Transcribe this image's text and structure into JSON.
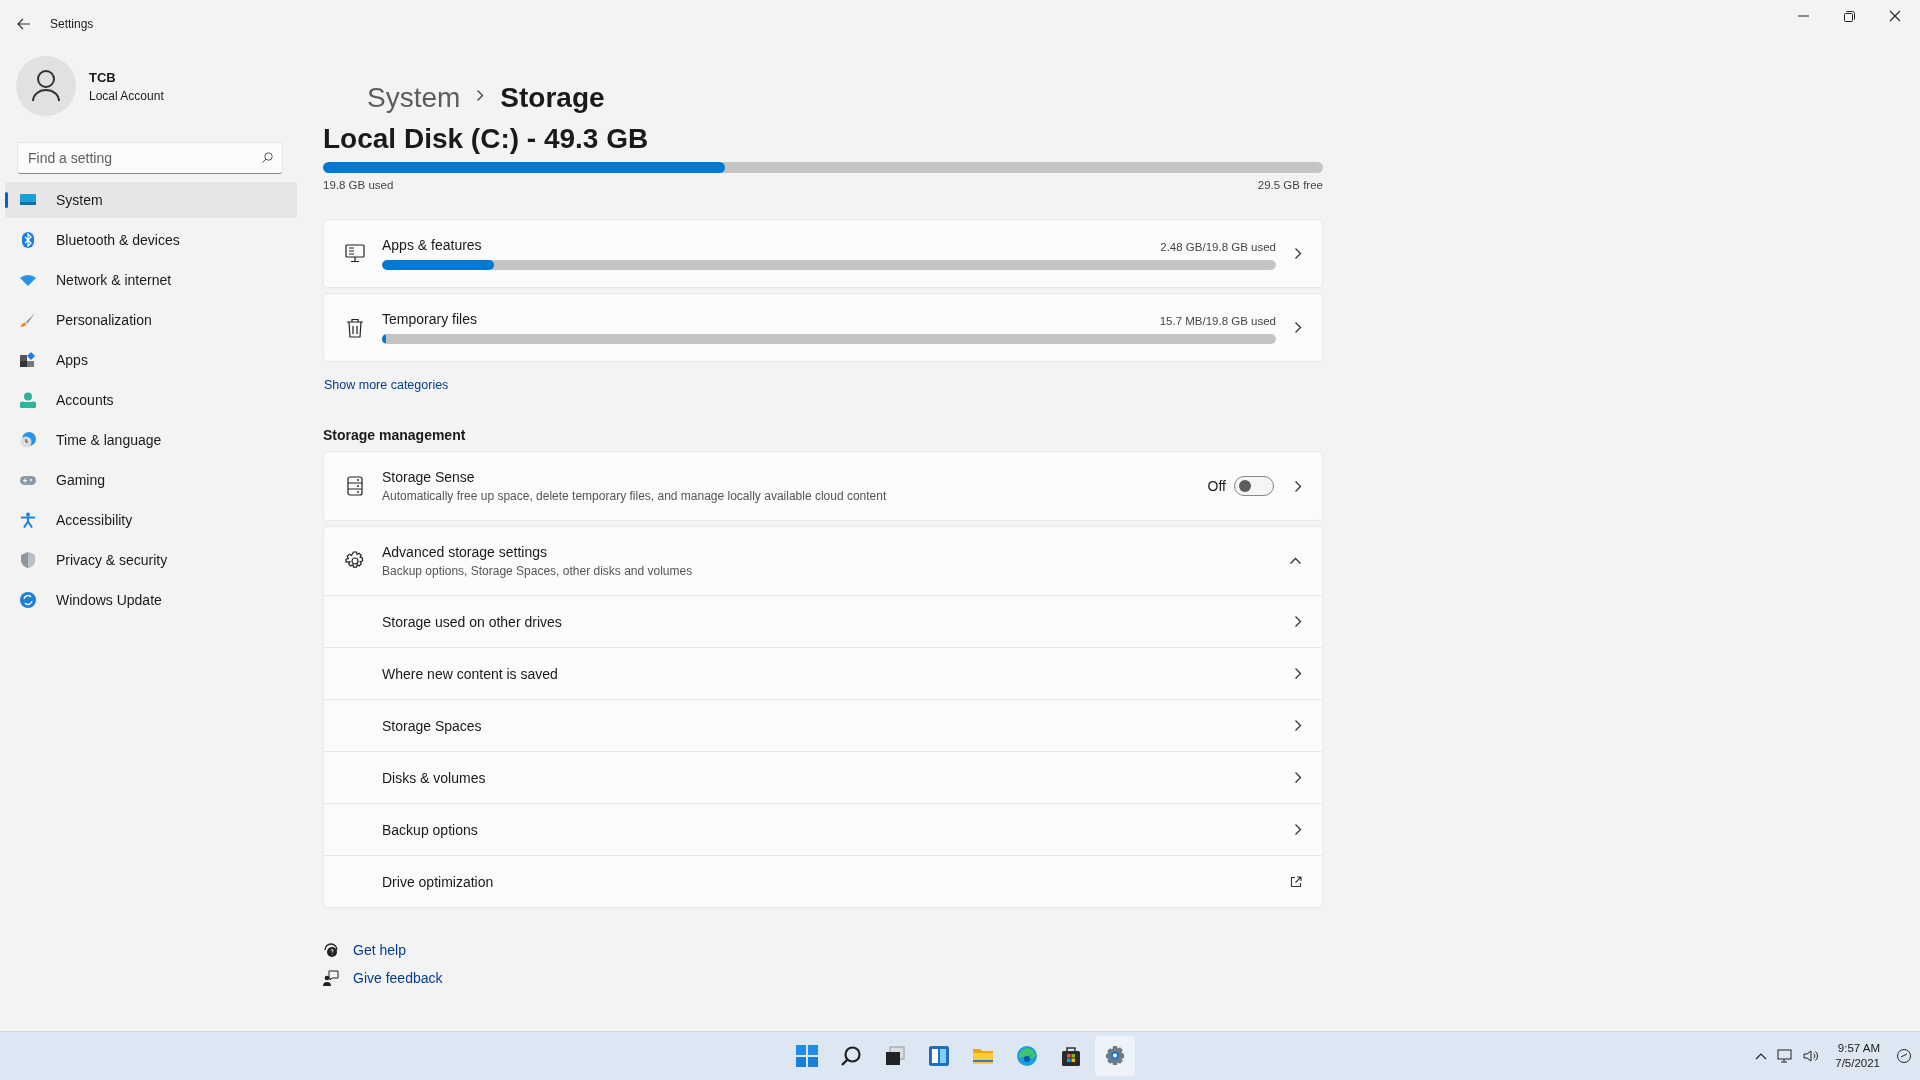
{
  "window": {
    "title": "Settings"
  },
  "account": {
    "name": "TCB",
    "type": "Local Account"
  },
  "search": {
    "placeholder": "Find a setting"
  },
  "nav": [
    {
      "label": "System",
      "selected": true
    },
    {
      "label": "Bluetooth & devices",
      "selected": false
    },
    {
      "label": "Network & internet",
      "selected": false
    },
    {
      "label": "Personalization",
      "selected": false
    },
    {
      "label": "Apps",
      "selected": false
    },
    {
      "label": "Accounts",
      "selected": false
    },
    {
      "label": "Time & language",
      "selected": false
    },
    {
      "label": "Gaming",
      "selected": false
    },
    {
      "label": "Accessibility",
      "selected": false
    },
    {
      "label": "Privacy & security",
      "selected": false
    },
    {
      "label": "Windows Update",
      "selected": false
    }
  ],
  "breadcrumb": [
    "System",
    "Storage"
  ],
  "disk": {
    "title": "Local Disk (C:) - 49.3 GB",
    "level": 0.402,
    "used": "19.8 GB used",
    "free": "29.5 GB free"
  },
  "categories": [
    {
      "label": "Apps & features",
      "usage": "2.48 GB/19.8 GB used",
      "level": 0.125
    },
    {
      "label": "Temporary files",
      "usage": "15.7 MB/19.8 GB used",
      "level": 0.004
    }
  ],
  "show_more": "Show more categories",
  "management": {
    "heading": "Storage management",
    "storage_sense": {
      "title": "Storage Sense",
      "description": "Automatically free up space, delete temporary files, and manage locally available cloud content",
      "state_label": "Off",
      "on": false
    },
    "advanced": {
      "title": "Advanced storage settings",
      "description": "Backup options, Storage Spaces, other disks and volumes",
      "expanded": true,
      "items": [
        {
          "label": "Storage used on other drives",
          "kind": "link"
        },
        {
          "label": "Where new content is saved",
          "kind": "link"
        },
        {
          "label": "Storage Spaces",
          "kind": "link"
        },
        {
          "label": "Disks & volumes",
          "kind": "link"
        },
        {
          "label": "Backup options",
          "kind": "link"
        },
        {
          "label": "Drive optimization",
          "kind": "external"
        }
      ]
    }
  },
  "help_links": [
    "Get help",
    "Give feedback"
  ],
  "taskbar": {
    "apps": [
      {
        "selected": false
      },
      {
        "selected": false
      },
      {
        "selected": false
      },
      {
        "selected": false
      },
      {
        "selected": false
      },
      {
        "selected": false
      },
      {
        "selected": false
      },
      {
        "selected": true
      }
    ],
    "time": "9:57 AM",
    "date": "7/5/2021"
  }
}
